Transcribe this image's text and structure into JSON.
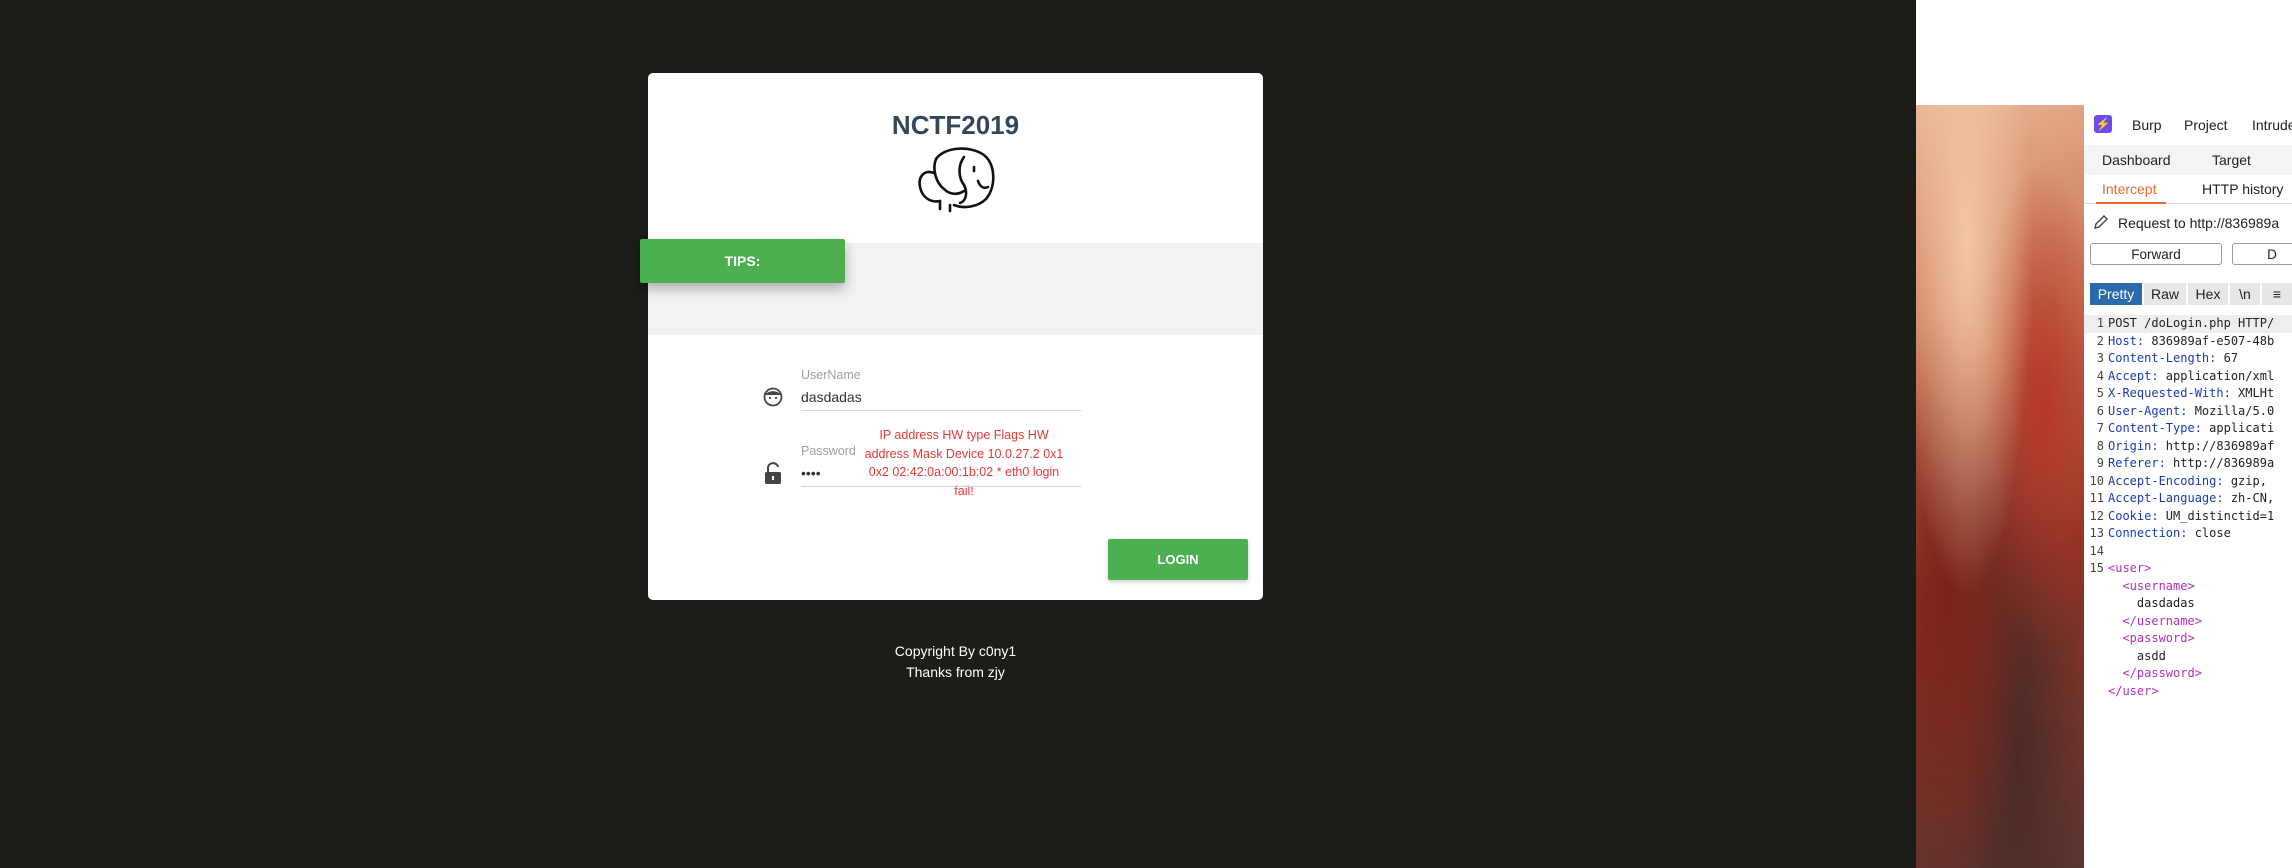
{
  "login": {
    "title": "NCTF2019",
    "tips_label": "TIPS:",
    "tips_message": "IP address HW type Flags HW address Mask Device 10.0.27.2 0x1 0x2 02:42:0a:00:1b:02 * eth0 login fail!",
    "username_label": "UserName",
    "username_value": "dasdadas",
    "password_label": "Password",
    "password_value": "asdd",
    "login_button": "LOGIN",
    "copyright_line1": "Copyright By c0ny1",
    "copyright_line2": "Thanks from zjy"
  },
  "burp": {
    "menu": [
      "Burp",
      "Project",
      "Intrude"
    ],
    "top_tabs": [
      "Dashboard",
      "Target"
    ],
    "proxy_tabs": [
      "Intercept",
      "HTTP history"
    ],
    "request_label": "Request to http://836989a",
    "forward_button": "Forward",
    "drop_button": "D",
    "view_tabs": [
      "Pretty",
      "Raw",
      "Hex",
      "\\n",
      "≡"
    ],
    "request_lines": [
      {
        "n": "1",
        "name": "POST /doLogin.php HTTP/",
        "value": ""
      },
      {
        "n": "2",
        "name": "Host:",
        "value": " 836989af-e507-48b"
      },
      {
        "n": "3",
        "name": "Content-Length:",
        "value": " 67"
      },
      {
        "n": "4",
        "name": "Accept:",
        "value": " application/xml"
      },
      {
        "n": "5",
        "name": "X-Requested-With:",
        "value": " XMLHt"
      },
      {
        "n": "6",
        "name": "User-Agent:",
        "value": " Mozilla/5.0"
      },
      {
        "n": "7",
        "name": "Content-Type:",
        "value": " applicati"
      },
      {
        "n": "8",
        "name": "Origin:",
        "value": " http://836989af"
      },
      {
        "n": "9",
        "name": "Referer:",
        "value": " http://836989a"
      },
      {
        "n": "10",
        "name": "Accept-Encoding:",
        "value": " gzip,"
      },
      {
        "n": "11",
        "name": "Accept-Language:",
        "value": " zh-CN,"
      },
      {
        "n": "12",
        "name": "Cookie:",
        "value": " UM_distinctid=1"
      },
      {
        "n": "13",
        "name": "Connection:",
        "value": " close"
      },
      {
        "n": "14",
        "name": "",
        "value": ""
      },
      {
        "n": "15",
        "name": "",
        "value": ""
      }
    ],
    "xml_lines": [
      {
        "indent": "",
        "kind": "tag",
        "text": "<user>"
      },
      {
        "indent": "  ",
        "kind": "tag",
        "text": "<username>"
      },
      {
        "indent": "    ",
        "kind": "text",
        "text": "dasdadas"
      },
      {
        "indent": "  ",
        "kind": "tag",
        "text": "</username>"
      },
      {
        "indent": "  ",
        "kind": "tag",
        "text": "<password>"
      },
      {
        "indent": "    ",
        "kind": "text",
        "text": "asdd"
      },
      {
        "indent": "  ",
        "kind": "tag",
        "text": "</password>"
      },
      {
        "indent": "",
        "kind": "tag",
        "text": "</user>"
      }
    ]
  },
  "colors": {
    "page_bg": "#1c1c19",
    "accent_green": "#4caf50",
    "error_red": "#e53935",
    "burp_orange": "#e8692c",
    "burp_blue": "#2a6aad"
  },
  "icons": {
    "logo": "elephant-icon",
    "username": "user-face-icon",
    "password": "unlocked-padlock-icon",
    "burp_logo": "burp-logo-icon",
    "edit": "pencil-icon"
  }
}
